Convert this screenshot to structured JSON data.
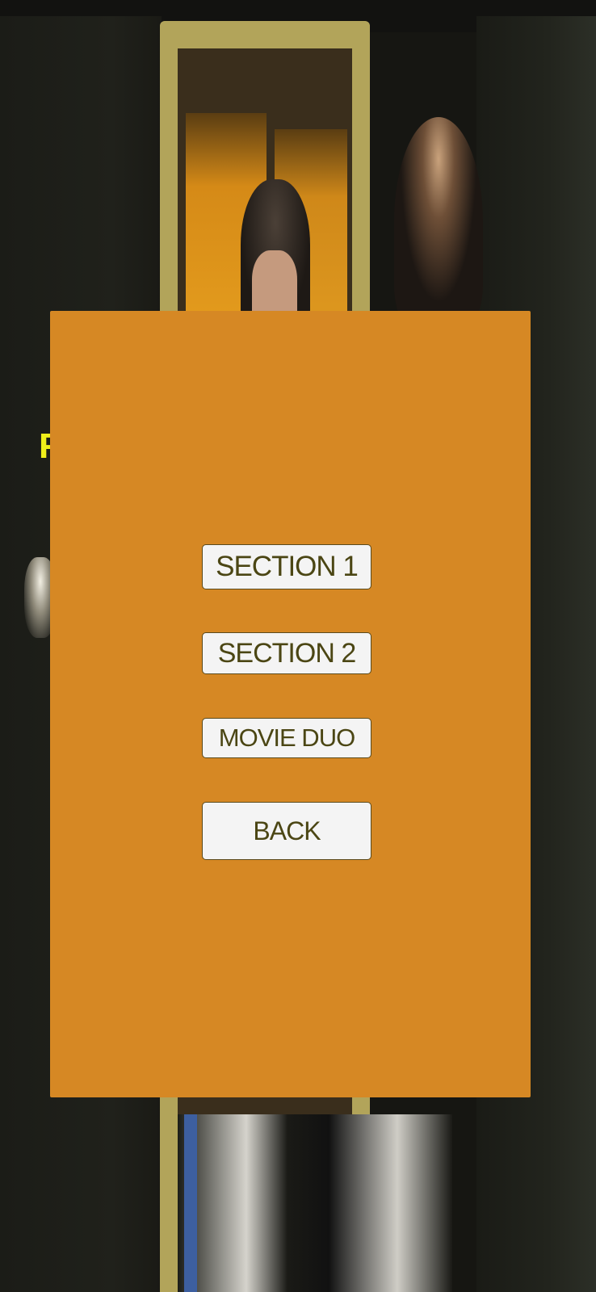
{
  "background": {
    "sign_text": "F"
  },
  "menu": {
    "panel_color": "#d68824",
    "buttons": [
      {
        "label": "SECTION 1"
      },
      {
        "label": "SECTION 2"
      },
      {
        "label": "MOVIE DUO"
      },
      {
        "label": "BACK"
      }
    ]
  }
}
